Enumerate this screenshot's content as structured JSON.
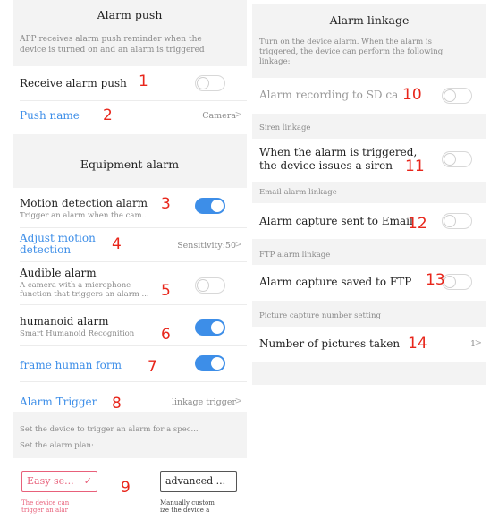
{
  "left": {
    "alarm_push": {
      "title": "Alarm push",
      "hint_line1": "APP receives alarm push reminder when the",
      "hint_line2": "device is turned on and an alarm is triggered",
      "receive_label": "Receive alarm push",
      "receive_on": false,
      "push_name_label": "Push name",
      "push_name_value": "Camera"
    },
    "equipment_alarm": {
      "title": "Equipment alarm",
      "motion_label": "Motion detection alarm",
      "motion_sub": "Trigger an alarm when the cam...",
      "motion_on": true,
      "adjust_label_line1": "Adjust motion",
      "adjust_label_line2": "detection",
      "sensitivity_value": "Sensitivity:50",
      "audible_label": "Audible alarm",
      "audible_sub_line1": "A camera with a microphone",
      "audible_sub_line2": "function that triggers an alarm ...",
      "audible_on": false,
      "humanoid_label": "humanoid alarm",
      "humanoid_sub": "Smart Humanoid Recognition",
      "humanoid_on": true,
      "frame_label": "frame human form",
      "frame_on": true,
      "trigger_label": "Alarm Trigger",
      "trigger_value": "linkage trigger",
      "plan_hint1": "Set the device to trigger an alarm for a spec...",
      "plan_hint2": "Set the alarm plan:",
      "easy_label": "Easy se...",
      "easy_check": "✓",
      "easy_desc1": "The device can",
      "easy_desc2": "trigger an alar",
      "advanced_label": "advanced ...",
      "advanced_desc1": "Manually custom",
      "advanced_desc2": "ize the device a"
    }
  },
  "right": {
    "title": "Alarm linkage",
    "hint_line1": "Turn on the device alarm. When the alarm is",
    "hint_line2": "triggered, the device can perform the following",
    "hint_line3": "linkage:",
    "sd_label": "Alarm recording to SD ca",
    "sd_on": false,
    "siren_header": "Siren linkage",
    "siren_label_line1": "When the alarm is triggered,",
    "siren_label_line2": "the device issues a siren",
    "siren_on": false,
    "email_header": "Email alarm linkage",
    "email_label": "Alarm capture sent to Email",
    "email_on": false,
    "ftp_header": "FTP alarm linkage",
    "ftp_label": "Alarm capture saved to FTP",
    "ftp_on": false,
    "capture_header": "Picture capture number setting",
    "pictures_label": "Number of pictures taken",
    "pictures_value": "1"
  },
  "annotations": [
    "1",
    "2",
    "3",
    "4",
    "5",
    "6",
    "7",
    "8",
    "9",
    "10",
    "11",
    "12",
    "13",
    "14"
  ],
  "chevron": ">",
  "colors": {
    "accent": "#3d8ee8",
    "annotation": "#e8261b",
    "selected_mode": "#e8607a"
  }
}
